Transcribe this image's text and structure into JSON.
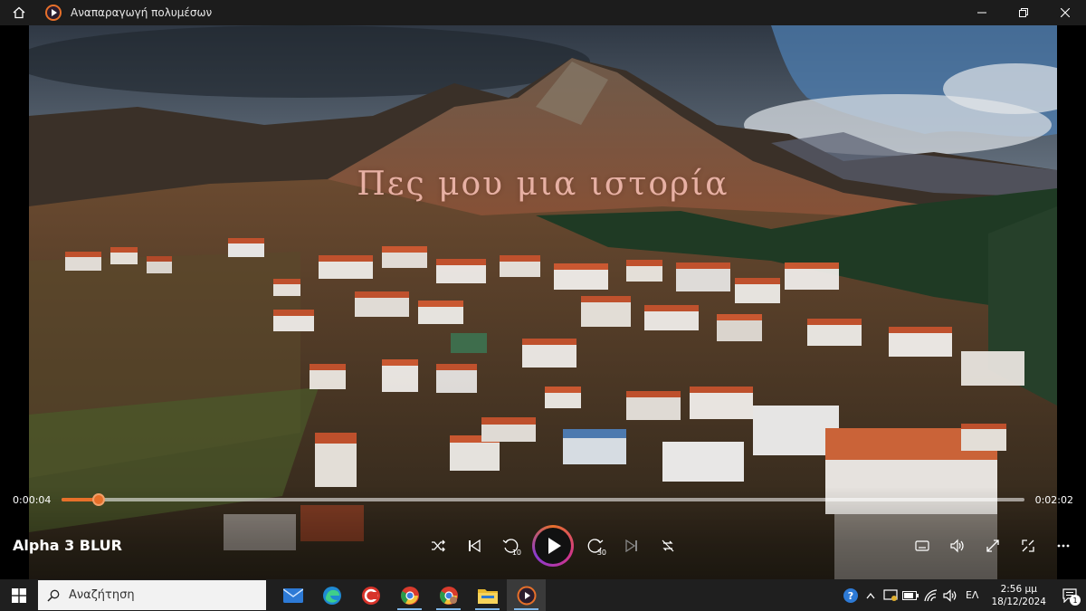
{
  "window": {
    "title": "Αναπαραγωγή πολυμέσων"
  },
  "video": {
    "caption": "Πες μου μια ιστορία"
  },
  "player": {
    "media_title": "Alpha 3 BLUR",
    "elapsed": "0:00:04",
    "duration": "0:02:02",
    "progress_fraction": 0.039,
    "skip_back_seconds": "10",
    "skip_forward_seconds": "30",
    "accent_color": "#e7702a"
  },
  "taskbar": {
    "search_placeholder": "Αναζήτηση",
    "language": "ΕΛ",
    "time": "2:56 μμ",
    "date": "18/12/2024",
    "notification_count": "1",
    "apps": [
      {
        "icon": "mail-icon"
      },
      {
        "icon": "edge-icon"
      },
      {
        "icon": "ccleaner-icon"
      },
      {
        "icon": "chrome-icon"
      },
      {
        "icon": "chrome-profile-icon"
      },
      {
        "icon": "file-explorer-icon"
      },
      {
        "icon": "media-player-icon"
      }
    ]
  }
}
